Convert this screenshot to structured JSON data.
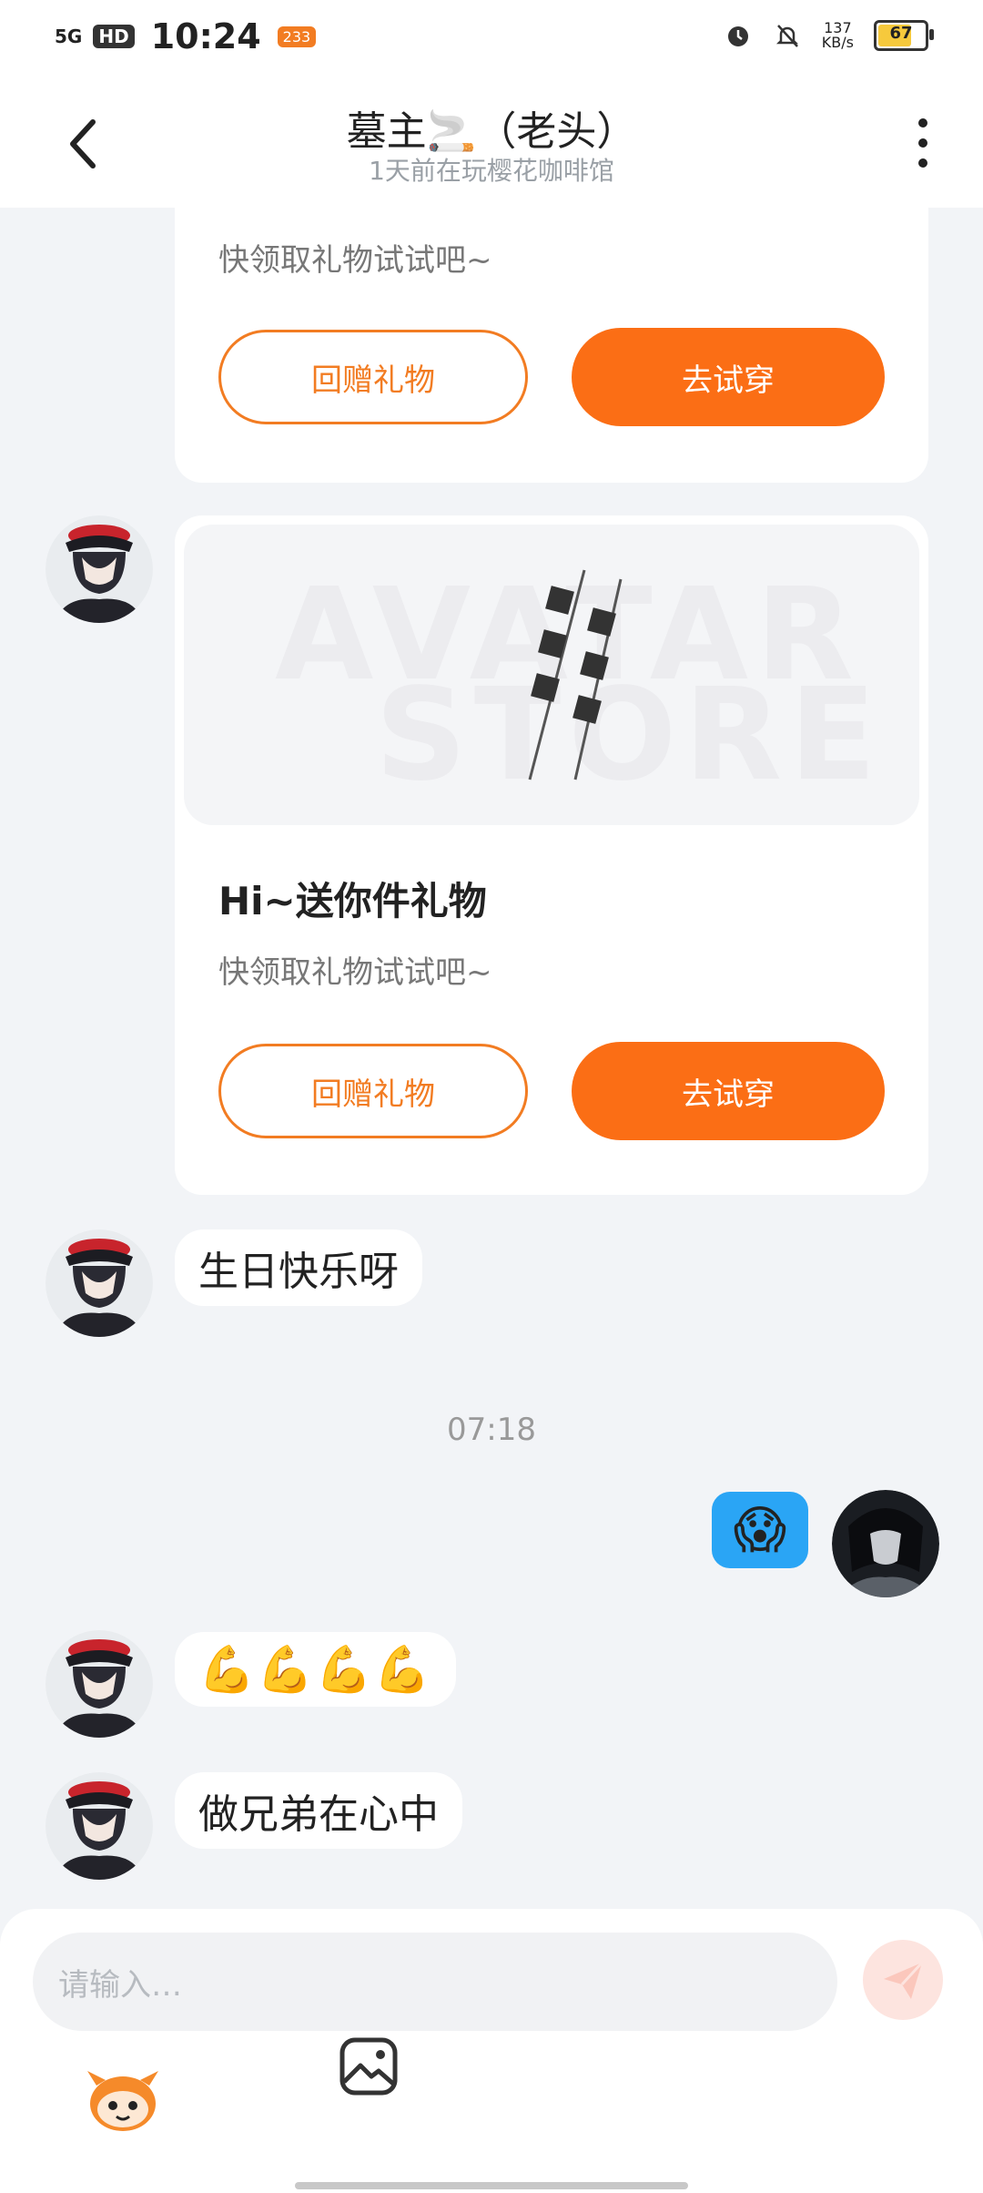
{
  "status_bar": {
    "network": "5G",
    "hd": "HD",
    "time": "10:24",
    "badge": "233",
    "speed_value": "137",
    "speed_unit": "KB/s",
    "battery": "67"
  },
  "header": {
    "title": "墓主🚬（老头）",
    "subtitle": "1天前在玩樱花咖啡馆"
  },
  "messages": {
    "card1": {
      "desc": "快领取礼物试试吧~",
      "return_gift": "回赠礼物",
      "try_on": "去试穿"
    },
    "card2": {
      "watermark_line1": "AVATAR",
      "watermark_line2": "STORE",
      "title": "Hi~送你件礼物",
      "desc": "快领取礼物试试吧~",
      "return_gift": "回赠礼物",
      "try_on": "去试穿"
    },
    "birthday": "生日快乐呀",
    "timestamp": "07:18",
    "my_emoji": "😱",
    "muscles": "💪💪💪💪",
    "brothers": "做兄弟在心中"
  },
  "input": {
    "placeholder": "请输入…"
  },
  "colors": {
    "accent": "#fb6e15",
    "background": "#f2f4f7"
  },
  "icons": {
    "back": "chevron-left-icon",
    "more": "more-vertical-icon",
    "send": "send-icon",
    "mascot": "mascot-icon",
    "image": "image-icon"
  }
}
